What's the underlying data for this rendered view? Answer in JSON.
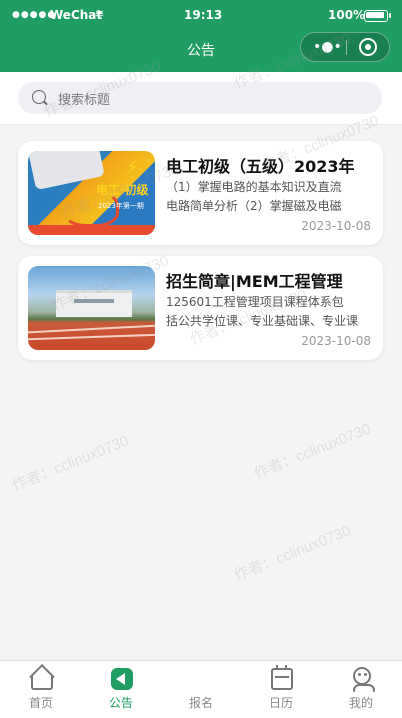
{
  "status_bar": {
    "carrier": "WeChat",
    "time": "19:13",
    "battery": "100%"
  },
  "nav": {
    "title": "公告"
  },
  "search": {
    "placeholder": "搜索标题"
  },
  "announcements": [
    {
      "title": "电工初级（五级）2023年",
      "desc_line1": "（1）掌握电路的基本知识及直流",
      "desc_line2": "电路简单分析（2）掌握磁及电磁",
      "date": "2023-10-08",
      "image_text": "电工·初级",
      "image_subtext": "2023年第一期"
    },
    {
      "title": "招生简章|MEM工程管理",
      "desc_line1": "125601工程管理项目课程体系包",
      "desc_line2": "括公共学位课、专业基础课、专业课",
      "date": "2023-10-08"
    }
  ],
  "watermark": "作者：cclinux0730",
  "tabs": [
    {
      "label": "首页",
      "icon": "home-icon",
      "active": false
    },
    {
      "label": "公告",
      "icon": "announcement-icon",
      "active": true
    },
    {
      "label": "报名",
      "icon": "grid-icon",
      "active": false
    },
    {
      "label": "日历",
      "icon": "calendar-icon",
      "active": false
    },
    {
      "label": "我的",
      "icon": "profile-icon",
      "active": false
    }
  ],
  "colors": {
    "primary": "#1f9d63",
    "background": "#f3f4f6"
  }
}
